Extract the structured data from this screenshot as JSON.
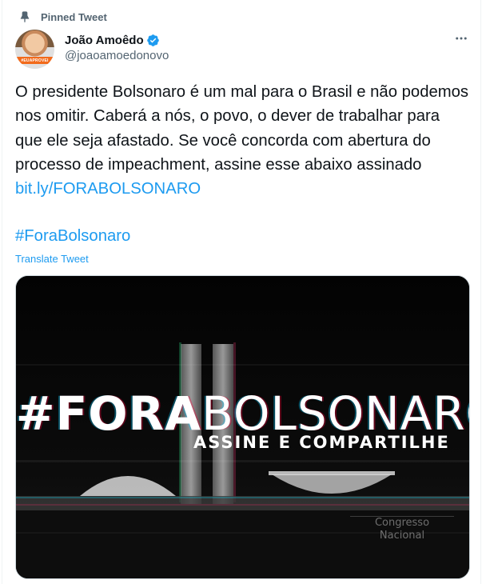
{
  "pinned": {
    "label": "Pinned Tweet",
    "icon": "pin-icon"
  },
  "author": {
    "name": "João Amoêdo",
    "handle": "@joaoamoedonovo",
    "verified_icon": "verified-badge-icon",
    "avatar_band_text": "#EUAPROVEI"
  },
  "more_icon": "more-options-icon",
  "tweet": {
    "text": "O presidente Bolsonaro é um mal para o Brasil e não podemos nos omitir. Caberá a nós, o povo, o dever de trabalhar para que ele seja afastado. Se você concorda com abertura do processo de impeachment, assine esse abaixo assinado ",
    "link": "bit.ly/FORABOLSONARO",
    "hashtag": "#ForaBolsonaro",
    "translate_label": "Translate Tweet"
  },
  "media": {
    "title_bold": "#FORA",
    "title_regular": "BOLSONARO",
    "subtitle": "ASSINE E COMPARTILHE",
    "sign_line1": "Congresso",
    "sign_line2": "Nacional"
  },
  "colors": {
    "link": "#1d9bf0",
    "secondary_text": "#536471",
    "primary_text": "#0f1419",
    "media_bg": "#050505"
  }
}
